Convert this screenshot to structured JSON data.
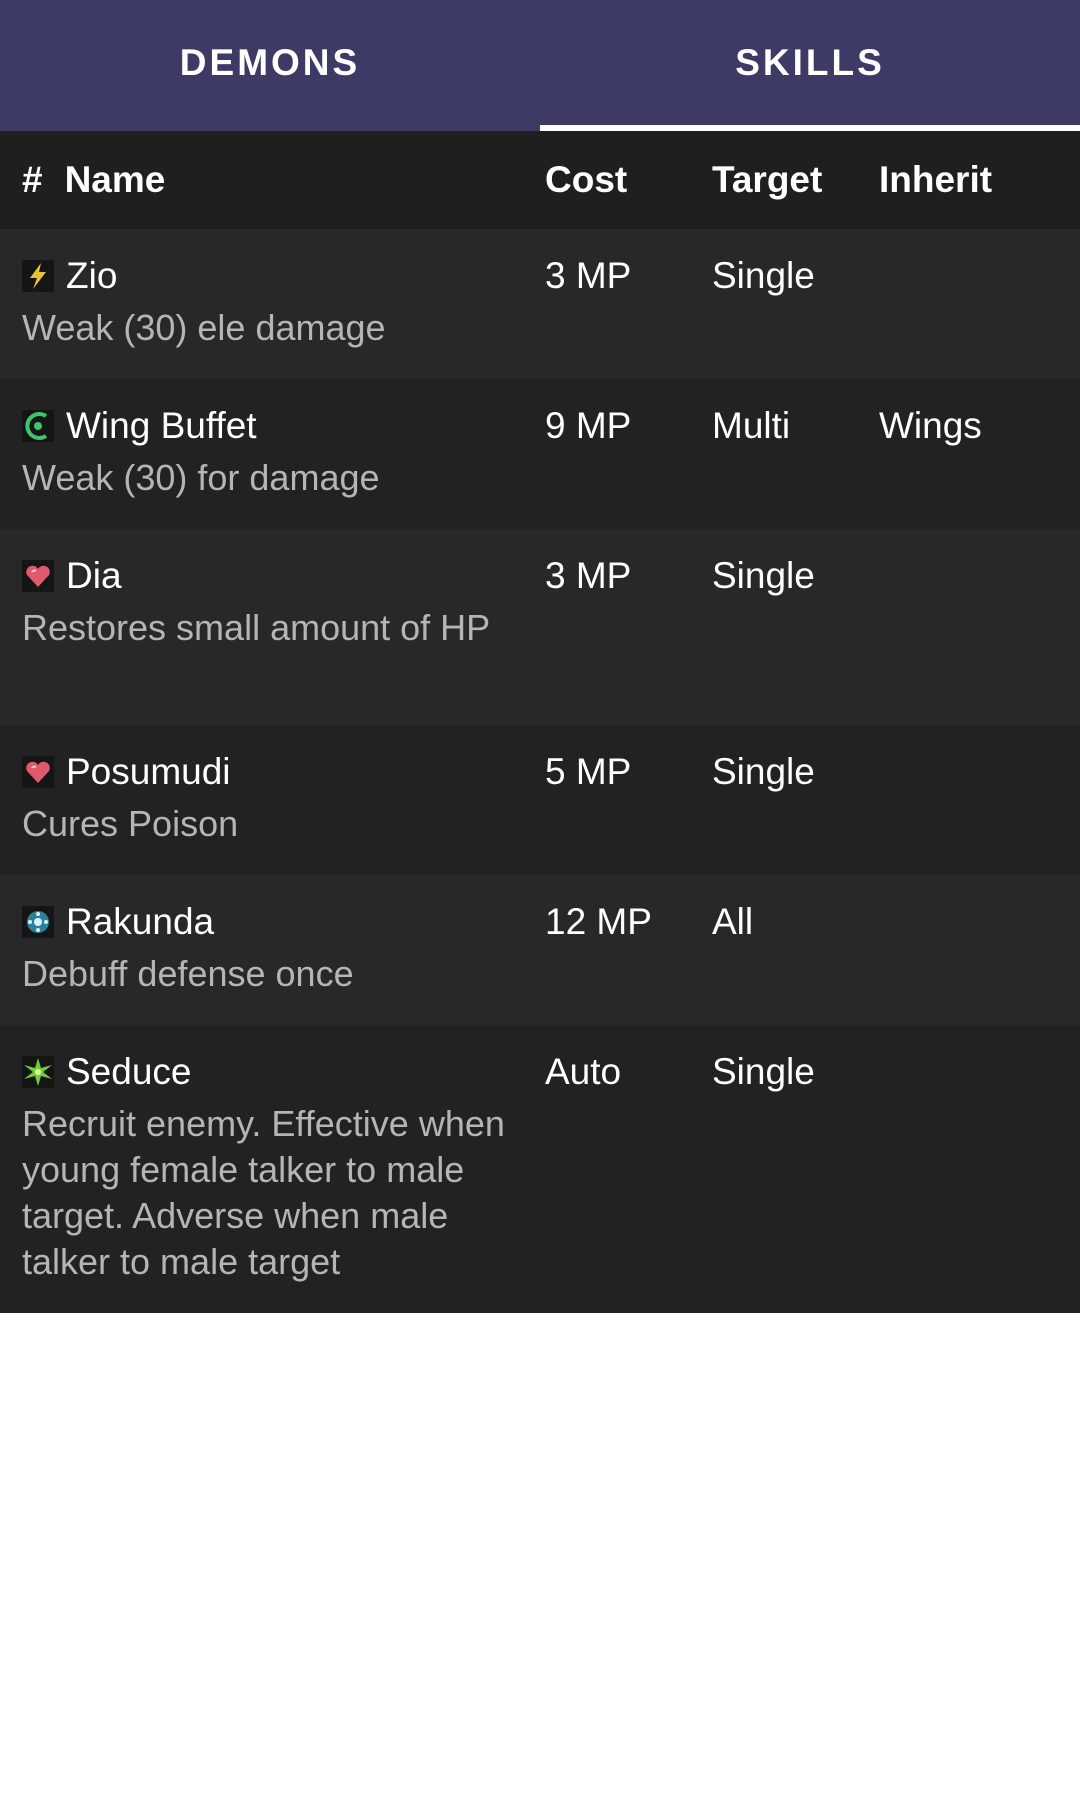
{
  "tabs": [
    {
      "label": "DEMONS",
      "active": false
    },
    {
      "label": "SKILLS",
      "active": true
    }
  ],
  "colors": {
    "tab_bar": "#3d3a66",
    "table_bg": "#1f1f1f",
    "row_alt": "#282828",
    "description_text": "#b5b5b5"
  },
  "table": {
    "headers": {
      "index": "#",
      "name": "Name",
      "cost": "Cost",
      "target": "Target",
      "inherit": "Inherit"
    },
    "rows": [
      {
        "icon": "electric-icon",
        "name": "Zio",
        "description": "Weak (30) ele damage",
        "cost": "3 MP",
        "target": "Single",
        "inherit": ""
      },
      {
        "icon": "wind-icon",
        "name": "Wing Buffet",
        "description": "Weak (30) for damage",
        "cost": "9 MP",
        "target": "Multi",
        "inherit": "Wings"
      },
      {
        "icon": "heart-icon",
        "name": "Dia",
        "description": "Restores small amount of HP",
        "cost": "3 MP",
        "target": "Single",
        "inherit": ""
      },
      {
        "icon": "heart-icon",
        "name": "Posumudi",
        "description": "Cures Poison",
        "cost": "5 MP",
        "target": "Single",
        "inherit": ""
      },
      {
        "icon": "debuff-icon",
        "name": "Rakunda",
        "description": "Debuff defense once",
        "cost": "12 MP",
        "target": "All",
        "inherit": ""
      },
      {
        "icon": "charm-icon",
        "name": "Seduce",
        "description": "Recruit enemy. Effective when young female talker to male target. Adverse when male talker to male target",
        "cost": "Auto",
        "target": "Single",
        "inherit": ""
      }
    ]
  }
}
